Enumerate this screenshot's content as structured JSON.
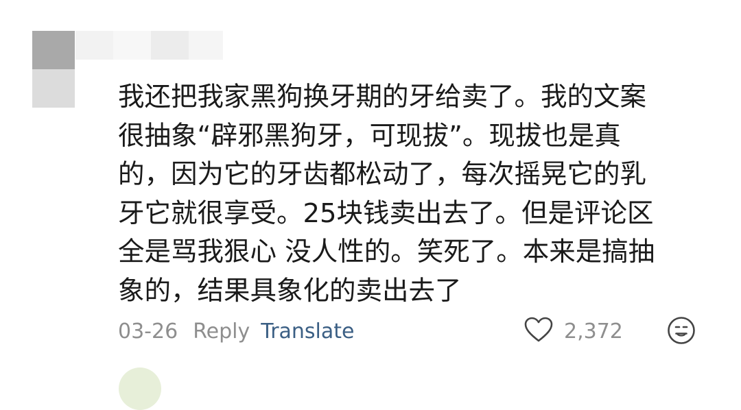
{
  "comment": {
    "lines": [
      "我还把我家黑狗换牙期的牙给卖了。我的文案",
      "很抽象“辟邪黑狗牙，可现拔”。现拔也是真",
      "的，因为它的牙齿都松动了，每次摇晃它的乳",
      "牙它就很享受。25块钱卖出去了。但是评论区",
      "全是骂我狠心 没人性的。笑死了。本来是搞抽",
      "象的，结果具象化的卖出去了"
    ],
    "date": "03-26",
    "reply_label": "Reply",
    "translate_label": "Translate",
    "like_count": "2,372"
  },
  "icons": {
    "like": "heart-outline-icon",
    "reaction": "smiley-face-icon"
  },
  "colors": {
    "text": "#1a1a1a",
    "meta": "#8e8e8e",
    "link": "#3b5f84"
  }
}
